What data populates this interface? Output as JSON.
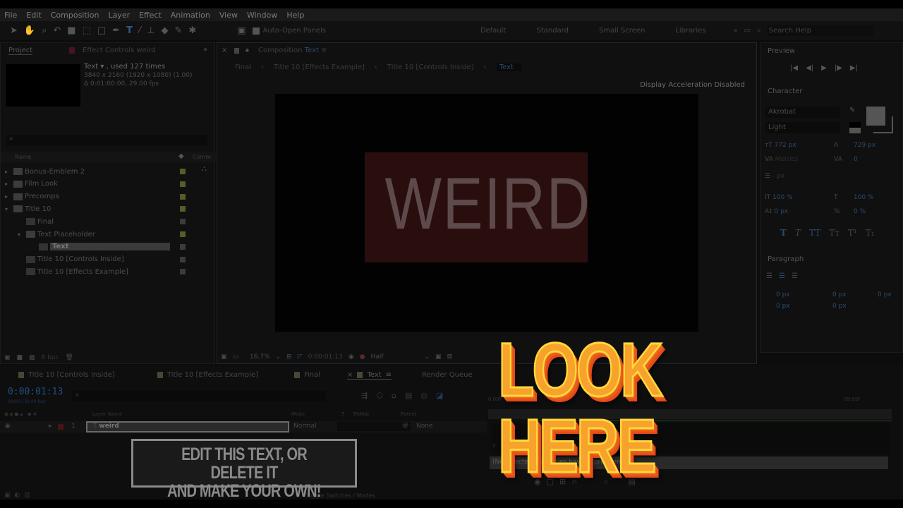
{
  "menu": [
    "File",
    "Edit",
    "Composition",
    "Layer",
    "Effect",
    "Animation",
    "View",
    "Window",
    "Help"
  ],
  "toolbar": {
    "auto_open": "Auto-Open Panels",
    "workspaces": [
      "Default",
      "Standard",
      "Small Screen",
      "Libraries"
    ],
    "search_placeholder": "Search Help"
  },
  "project": {
    "tab": "Project",
    "effect_tab": "Effect Controls weird",
    "item_name": "Text ▾ , used 127 times",
    "item_res": "3840 x 2160  (1920 x 1080) (1.00)",
    "item_dur": "Δ 0:01:00:00, 29.00 fps",
    "col_name": "Name",
    "col_comment": "Comm",
    "items": [
      {
        "label": "Bonus-Emblem 2",
        "type": "folder",
        "indent": 0,
        "arrow": "▸"
      },
      {
        "label": "Film Look",
        "type": "folder",
        "indent": 0,
        "arrow": "▸"
      },
      {
        "label": "Precomps",
        "type": "folder",
        "indent": 0,
        "arrow": "▸"
      },
      {
        "label": "Title 10",
        "type": "folder",
        "indent": 0,
        "arrow": "▾"
      },
      {
        "label": "Final",
        "type": "comp",
        "indent": 1,
        "arrow": ""
      },
      {
        "label": "Text Placeholder",
        "type": "folder",
        "indent": 1,
        "arrow": "▾"
      },
      {
        "label": "Text",
        "type": "comp",
        "indent": 2,
        "arrow": "",
        "selected": true
      },
      {
        "label": "Title 10 [Controls Inside]",
        "type": "comp",
        "indent": 1,
        "arrow": ""
      },
      {
        "label": "Title 10 [Effects Example]",
        "type": "comp",
        "indent": 1,
        "arrow": ""
      }
    ],
    "bpc": "8 bpc"
  },
  "composition": {
    "tab": "Composition",
    "tab_name": "Text",
    "breadcrumbs": [
      "Final",
      "Title 10 [Effects Example]",
      "Title 10 [Controls Inside]",
      "Text"
    ],
    "notice": "Display Acceleration Disabled",
    "canvas_text": "WEIRD",
    "zoom": "16.7%",
    "timecode": "0:00:01:13",
    "resolution": "Half"
  },
  "preview": {
    "title": "Preview"
  },
  "character": {
    "title": "Character",
    "font": "Akrobat",
    "style": "Light",
    "size": "772 px",
    "leading": "729 px",
    "kerning": "Metrics",
    "tracking": "0",
    "stroke": "- px",
    "vscale": "100 %",
    "hscale": "100 %",
    "baseline": "0 px",
    "tsume": "0 %",
    "styles": [
      "T",
      "T",
      "TT",
      "Tт",
      "T¹",
      "T₁"
    ]
  },
  "paragraph": {
    "title": "Paragraph",
    "values": [
      "0 px",
      "0 px",
      "0 px",
      "0 px",
      "0 px"
    ]
  },
  "timeline": {
    "tabs": [
      "Title 10 [Controls Inside]",
      "Title 10 [Effects Example]",
      "Final",
      "Text",
      "Render Queue"
    ],
    "timecode": "0:00:01:13",
    "frames": "00043 (29.00 fps)",
    "cols": {
      "name": "Layer Name",
      "mode": "Mode",
      "t": "T",
      "trkmat": "TrkMat",
      "parent": "Parent"
    },
    "layer": {
      "num": "1",
      "name": "weird",
      "mode": "Normal",
      "parent": "None"
    },
    "ruler_start": "0:00F",
    "ruler_end": "09:09f",
    "graph_zero": "0",
    "expressions": "(No selected properties have expressions.)",
    "toggle": "Toggle Switches / Modes"
  },
  "overlay": {
    "look_here": "LOOK HERE",
    "callout_line1": "EDIT THIS TEXT, OR DELETE IT",
    "callout_line2": "AND MAKE YOUR OWN!"
  },
  "colors": {
    "accent_blue": "#2d6fb8",
    "layer_label": "#8a1e1e",
    "canvas_red": "#2a0e0e",
    "look_fill": "#f7a22c",
    "look_stroke": "#ffd93a"
  }
}
